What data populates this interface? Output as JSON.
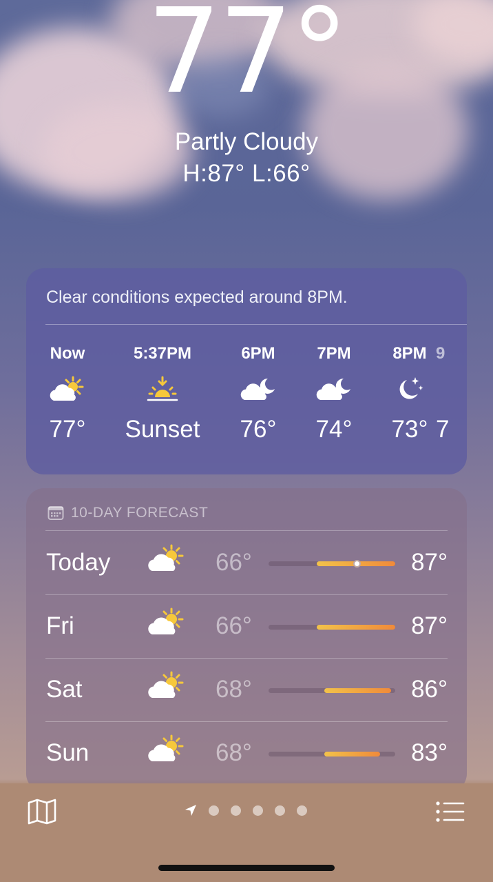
{
  "current": {
    "temperature": "77°",
    "condition": "Partly Cloudy",
    "hilo": "H:87°  L:66°"
  },
  "hourly": {
    "summary": "Clear conditions expected around 8PM.",
    "items": [
      {
        "time": "Now",
        "icon": "partly-cloudy-day-icon",
        "value": "77°"
      },
      {
        "time": "5:37PM",
        "icon": "sunset-icon",
        "value": "Sunset"
      },
      {
        "time": "6PM",
        "icon": "partly-cloudy-night-icon",
        "value": "76°"
      },
      {
        "time": "7PM",
        "icon": "partly-cloudy-night-icon",
        "value": "74°"
      },
      {
        "time": "8PM",
        "icon": "clear-night-icon",
        "value": "73°"
      }
    ]
  },
  "forecast": {
    "header": "10-DAY FORECAST",
    "days": [
      {
        "day": "Today",
        "icon": "partly-cloudy-day-icon",
        "low": "66°",
        "high": "87°",
        "range_start": 0.38,
        "range_end": 1.0,
        "current_marker": 0.7
      },
      {
        "day": "Fri",
        "icon": "partly-cloudy-day-icon",
        "low": "66°",
        "high": "87°",
        "range_start": 0.38,
        "range_end": 1.0
      },
      {
        "day": "Sat",
        "icon": "partly-cloudy-day-icon",
        "low": "68°",
        "high": "86°",
        "range_start": 0.44,
        "range_end": 0.97
      },
      {
        "day": "Sun",
        "icon": "partly-cloudy-day-icon",
        "low": "68°",
        "high": "83°",
        "range_start": 0.44,
        "range_end": 0.88
      }
    ]
  },
  "bottom_bar": {
    "map_icon": "map-icon",
    "location_icon": "location-arrow-icon",
    "page_dots": 5,
    "list_icon": "list-icon"
  },
  "colors": {
    "sun": "#f6c83b",
    "bar_start": "#f2c24a",
    "bar_end": "#f08a3a"
  }
}
